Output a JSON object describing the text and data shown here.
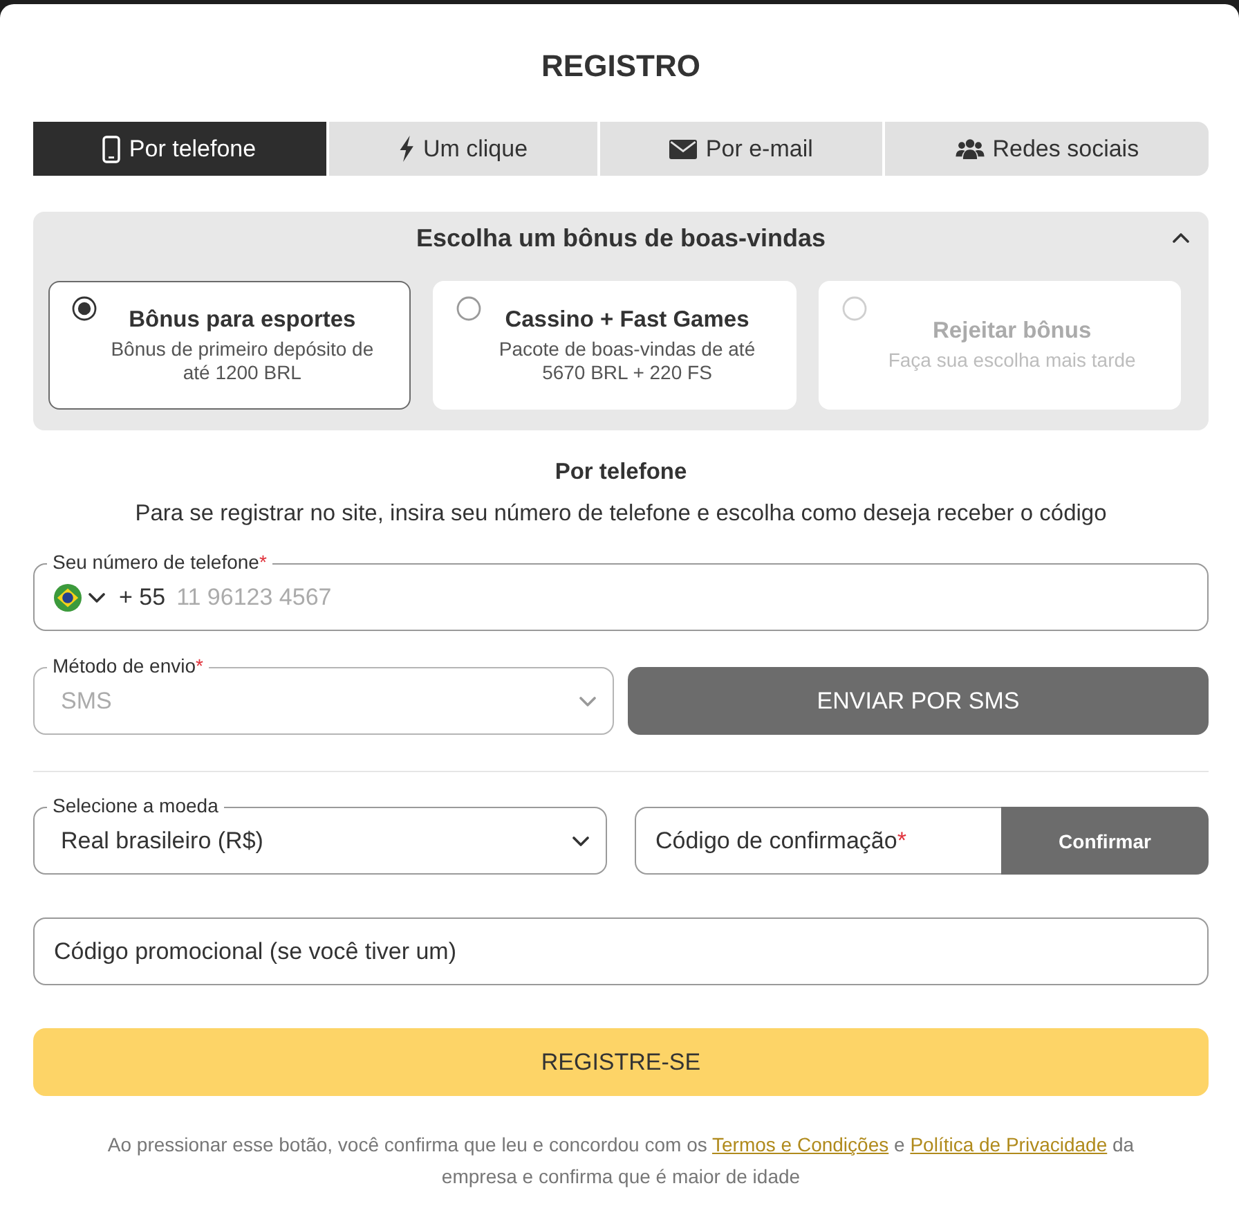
{
  "dialog": {
    "title": "REGISTRO"
  },
  "tabs": [
    {
      "label": "Por telefone",
      "kind": "phone",
      "selected": true
    },
    {
      "label": "Um clique",
      "kind": "lightning",
      "selected": false
    },
    {
      "label": "Por e-mail",
      "kind": "envelope",
      "selected": false
    },
    {
      "label": "Redes sociais",
      "kind": "people",
      "selected": false
    }
  ],
  "bonus": {
    "title": "Escolha um bônus de boas-vindas",
    "expanded": true,
    "options": [
      {
        "title": "Bônus para esportes",
        "description": "Bônus de primeiro depósito de até 1200 BRL",
        "selected": true,
        "disabled": false
      },
      {
        "title": "Cassino + Fast Games",
        "description": "Pacote de boas-vindas de até 5670 BRL + 220 FS",
        "selected": false,
        "disabled": false
      },
      {
        "title": "Rejeitar bônus",
        "description": "Faça sua escolha mais tarde",
        "selected": false,
        "disabled": true
      }
    ]
  },
  "section": {
    "title": "Por telefone",
    "description": "Para se registrar no site, insira seu número de telefone e escolha como deseja receber o código"
  },
  "phone": {
    "label": "Seu número de telefone",
    "required_mark": "*",
    "country_code": "+ 55",
    "placeholder": "11 96123 4567"
  },
  "send_method": {
    "label": "Método de envio",
    "required_mark": "*",
    "value": "SMS",
    "disabled": true
  },
  "send_button": {
    "label": "ENVIAR POR SMS"
  },
  "currency": {
    "label": "Selecione a moeda",
    "value": "Real brasileiro (R$)",
    "disabled": false
  },
  "confirmation": {
    "placeholder": "Código de confirmação",
    "required_mark": "*",
    "button": "Confirmar"
  },
  "promo": {
    "placeholder": "Código promocional (se você tiver um)"
  },
  "register_button": {
    "label": "REGISTRE-SE"
  },
  "legal": {
    "parts": [
      {
        "kind": "text",
        "text": "Ao pressionar esse botão, você confirma que leu e concordou com os "
      },
      {
        "kind": "link",
        "text": "Termos e Condições"
      },
      {
        "kind": "text",
        "text": " e "
      },
      {
        "kind": "link",
        "text": "Política de Privacidade"
      },
      {
        "kind": "text",
        "text": " da empresa e confirma que é maior de idade"
      }
    ]
  }
}
